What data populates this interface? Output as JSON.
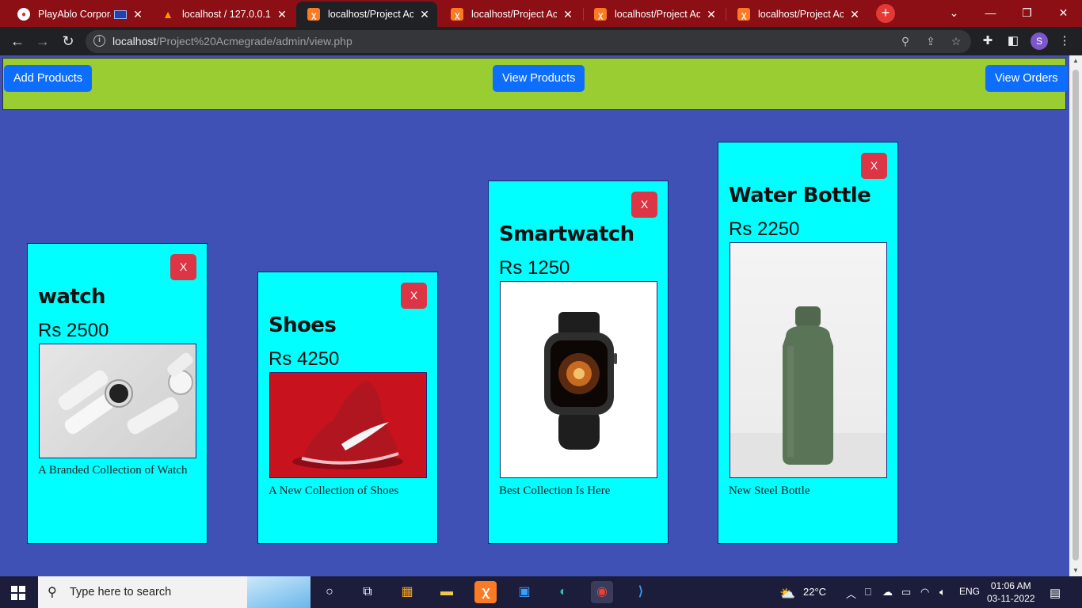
{
  "browser": {
    "tabs": [
      {
        "title": "PlayAblo Corporat",
        "favicon": "playablo-icon",
        "active": false
      },
      {
        "title": "localhost / 127.0.0.1 /",
        "favicon": "phpmyadmin-icon",
        "active": false
      },
      {
        "title": "localhost/Project Acm",
        "favicon": "xampp-icon",
        "active": true
      },
      {
        "title": "localhost/Project Acm",
        "favicon": "xampp-icon",
        "active": false
      },
      {
        "title": "localhost/Project Acm",
        "favicon": "xampp-icon",
        "active": false
      },
      {
        "title": "localhost/Project Acm",
        "favicon": "xampp-icon",
        "active": false
      }
    ],
    "url_host": "localhost",
    "url_path": "/Project%20Acmegrade/admin/view.php",
    "profile_initial": "S"
  },
  "nav": {
    "add_label": "Add Products",
    "view_label": "View Products",
    "orders_label": "View Orders",
    "bg_color": "#9acd32",
    "button_color": "#0d6efd"
  },
  "products": [
    {
      "name": "watch",
      "price": "Rs 2500",
      "description": "A Branded Collection of Watch",
      "delete_label": "X",
      "image": "white-smartwatch-photo"
    },
    {
      "name": "Shoes",
      "price": "Rs 4250",
      "description": "A New Collection of Shoes",
      "delete_label": "X",
      "image": "red-sneaker-photo"
    },
    {
      "name": "Smartwatch",
      "price": "Rs 1250",
      "description": "Best Collection Is Here",
      "delete_label": "X",
      "image": "black-smartwatch-photo"
    },
    {
      "name": "Water Bottle",
      "price": "Rs 2250",
      "description": "New Steel Bottle",
      "delete_label": "X",
      "image": "green-steel-bottle-photo"
    }
  ],
  "taskbar": {
    "search_placeholder": "Type here to search",
    "weather": "22°C",
    "language": "ENG",
    "time": "01:06 AM",
    "date": "03-11-2022"
  },
  "colors": {
    "page_bg": "#3f51b5",
    "card_bg": "#00ffff",
    "delete_button": "#dc3545"
  }
}
